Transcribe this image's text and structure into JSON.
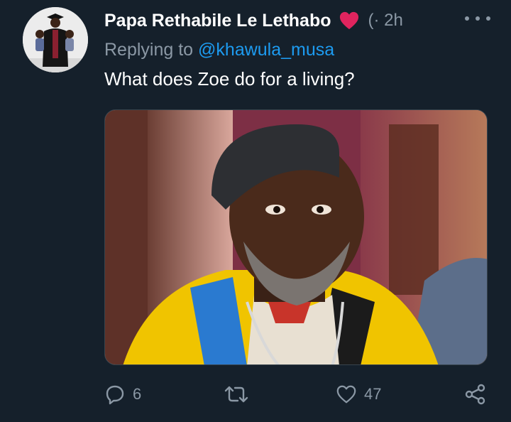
{
  "tweet": {
    "author_name": "Papa Rethabile Le Lethabo",
    "handle_time": "(· 2h",
    "reply_prefix": "Replying to ",
    "reply_to": "@khawula_musa",
    "text": "What does Zoe do for a living?"
  },
  "actions": {
    "reply_count": "6",
    "retweet_count": "",
    "like_count": "47"
  },
  "colors": {
    "background": "#15202b",
    "secondary_text": "#8b98a5",
    "link": "#1d9bf0",
    "heart_emoji": "#e0245e"
  },
  "icons": [
    "red-heart-emoji-icon",
    "more-options-icon",
    "reply-icon",
    "retweet-icon",
    "like-icon",
    "share-icon"
  ]
}
